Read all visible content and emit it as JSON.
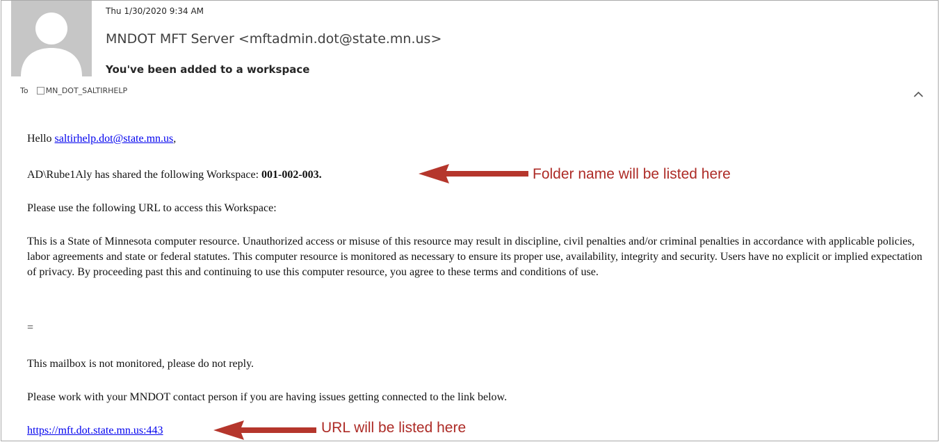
{
  "email": {
    "sent_time": "Thu 1/30/2020 9:34 AM",
    "sender": "MNDOT MFT Server <mftadmin.dot@state.mn.us>",
    "subject": "You've been added to a workspace",
    "to_label": "To",
    "recipient": "MN_DOT_SALTIRHELP"
  },
  "body": {
    "greeting_prefix": "Hello ",
    "greeting_email": "saltirhelp.dot@state.mn.us",
    "greeting_suffix": ",",
    "shared_prefix": "AD\\Rube1Aly has shared the following Workspace: ",
    "workspace_name": "001-002-003.",
    "url_instruction": "Please use the following URL to access this Workspace:",
    "notice": "This is a State of Minnesota computer resource. Unauthorized access or misuse of this resource may result in discipline, civil penalties and/or criminal penalties in accordance with applicable policies, labor agreements and state or federal statutes. This computer resource is monitored as necessary to ensure its proper use, availability, integrity and security. Users have no explicit or implied expectation of privacy. By proceeding past this and continuing to use this computer resource, you agree to these terms and conditions of use.",
    "separator": "=",
    "not_monitored": "This mailbox is not monitored, please do not reply.",
    "contact_note": "Please work with your MNDOT contact person if you are having issues getting connected to the link below.",
    "link_url": "https://mft.dot.state.mn.us:443"
  },
  "annotations": {
    "folder_note": "Folder name will be listed here",
    "url_note": "URL will be listed here",
    "color": "#ad2b26"
  },
  "icons": {
    "avatar": "person-silhouette-icon",
    "recipient": "checkbox-icon",
    "collapse": "chevron-up-icon",
    "arrow": "arrow-left-icon"
  }
}
